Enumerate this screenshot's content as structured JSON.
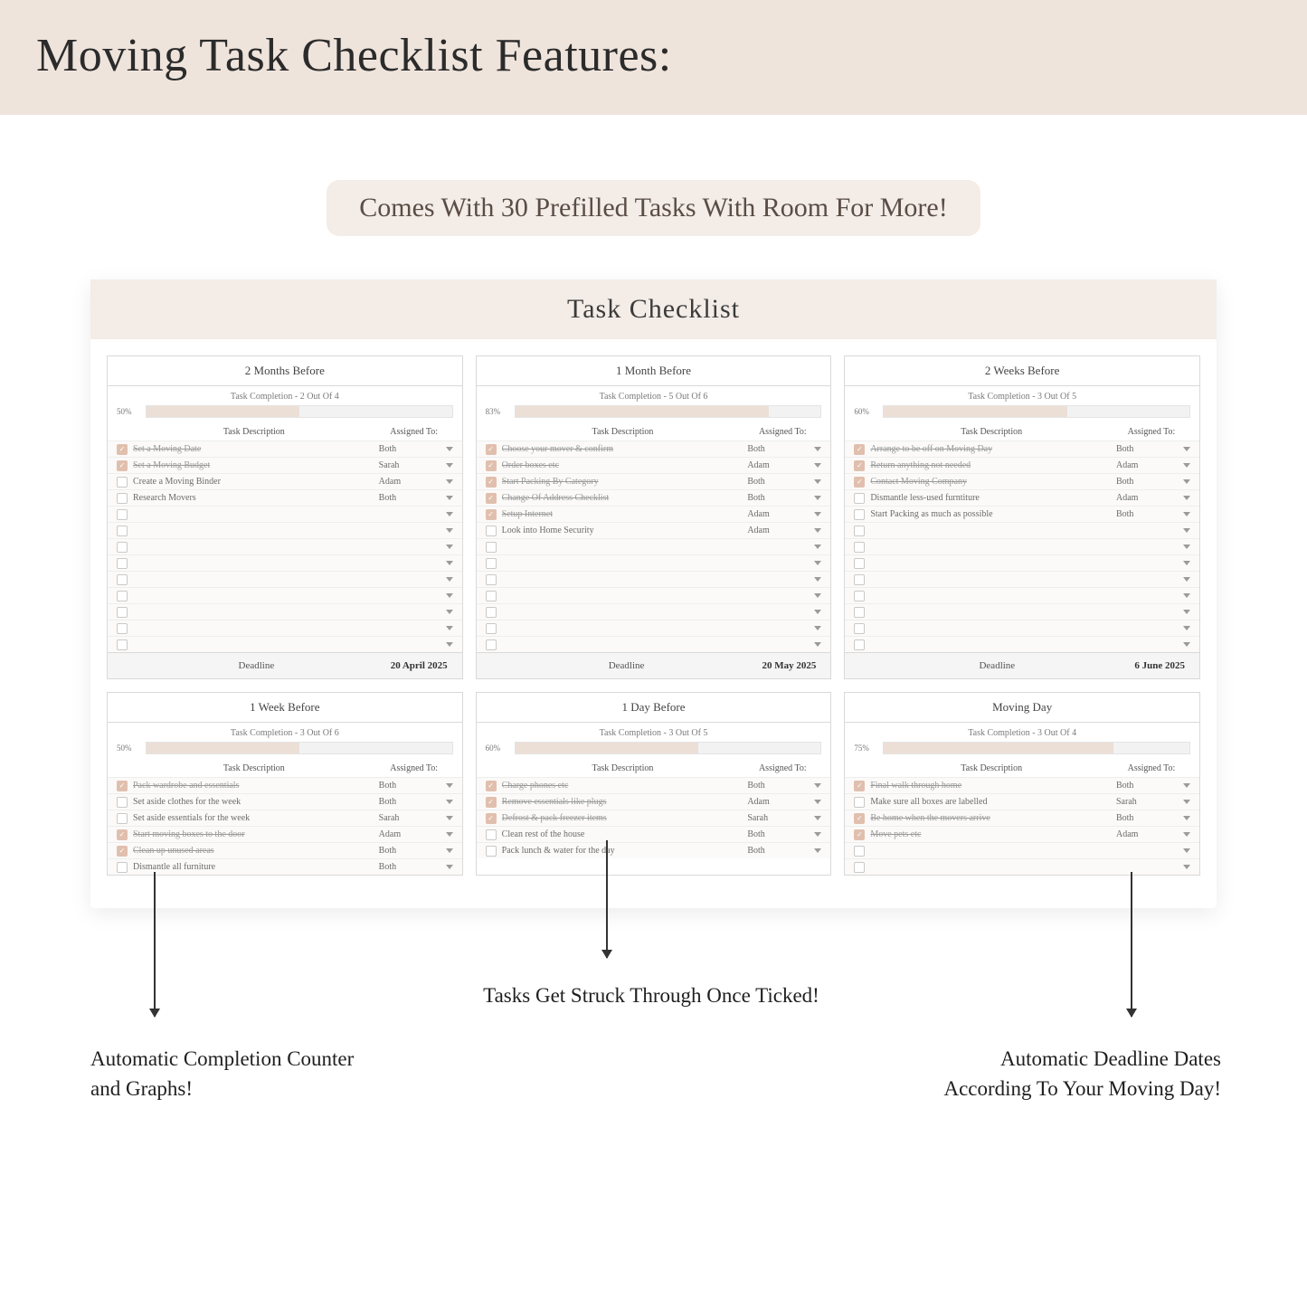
{
  "hero": {
    "title": "Moving Task Checklist Features:"
  },
  "subhead": {
    "text": "Comes With 30 Prefilled Tasks With Room For More!"
  },
  "sheetTitle": "Task Checklist",
  "panels": [
    {
      "title": "2 Months Before",
      "completionText": "Task Completion - 2 Out Of 4",
      "pct": "50%",
      "fill": 50,
      "colHeaders": {
        "desc": "Task Description",
        "assigned": "Assigned To:"
      },
      "rows": [
        {
          "done": true,
          "desc": "Set a Moving Date",
          "assigned": "Both"
        },
        {
          "done": true,
          "desc": "Set a Moving Budget",
          "assigned": "Sarah"
        },
        {
          "done": false,
          "desc": "Create a Moving Binder",
          "assigned": "Adam"
        },
        {
          "done": false,
          "desc": "Research Movers",
          "assigned": "Both"
        }
      ],
      "emptyRows": 9,
      "deadlineLabel": "Deadline",
      "deadline": "20 April 2025"
    },
    {
      "title": "1 Month Before",
      "completionText": "Task Completion - 5 Out Of 6",
      "pct": "83%",
      "fill": 83,
      "colHeaders": {
        "desc": "Task Description",
        "assigned": "Assigned To:"
      },
      "rows": [
        {
          "done": true,
          "desc": "Choose your mover & confirm",
          "assigned": "Both"
        },
        {
          "done": true,
          "desc": "Order boxes etc",
          "assigned": "Adam"
        },
        {
          "done": true,
          "desc": "Start Packing By Category",
          "assigned": "Both"
        },
        {
          "done": true,
          "desc": "Change Of Address Checklist",
          "assigned": "Both"
        },
        {
          "done": true,
          "desc": "Setup Internet",
          "assigned": "Adam"
        },
        {
          "done": false,
          "desc": "Look into Home Security",
          "assigned": "Adam"
        }
      ],
      "emptyRows": 7,
      "deadlineLabel": "Deadline",
      "deadline": "20 May 2025"
    },
    {
      "title": "2 Weeks Before",
      "completionText": "Task Completion - 3 Out Of 5",
      "pct": "60%",
      "fill": 60,
      "colHeaders": {
        "desc": "Task Description",
        "assigned": "Assigned To:"
      },
      "rows": [
        {
          "done": true,
          "desc": "Arrange to be off on Moving Day",
          "assigned": "Both"
        },
        {
          "done": true,
          "desc": "Return anything not needed",
          "assigned": "Adam"
        },
        {
          "done": true,
          "desc": "Contact Moving Company",
          "assigned": "Both"
        },
        {
          "done": false,
          "desc": "Dismantle less-used furntiture",
          "assigned": "Adam"
        },
        {
          "done": false,
          "desc": "Start Packing as much as possible",
          "assigned": "Both"
        }
      ],
      "emptyRows": 8,
      "deadlineLabel": "Deadline",
      "deadline": "6 June 2025"
    },
    {
      "title": "1 Week Before",
      "completionText": "Task Completion - 3 Out Of 6",
      "pct": "50%",
      "fill": 50,
      "colHeaders": {
        "desc": "Task Description",
        "assigned": "Assigned To:"
      },
      "rows": [
        {
          "done": true,
          "desc": "Pack wardrobe and essentials",
          "assigned": "Both"
        },
        {
          "done": false,
          "desc": "Set aside clothes for the week",
          "assigned": "Both"
        },
        {
          "done": false,
          "desc": "Set aside essentials for the week",
          "assigned": "Sarah"
        },
        {
          "done": true,
          "desc": "Start moving boxes to the door",
          "assigned": "Adam"
        },
        {
          "done": true,
          "desc": "Clean up unused areas",
          "assigned": "Both"
        },
        {
          "done": false,
          "desc": "Dismantle all furniture",
          "assigned": "Both"
        }
      ],
      "emptyRows": 0
    },
    {
      "title": "1 Day Before",
      "completionText": "Task Completion - 3 Out Of 5",
      "pct": "60%",
      "fill": 60,
      "colHeaders": {
        "desc": "Task Description",
        "assigned": "Assigned To:"
      },
      "rows": [
        {
          "done": true,
          "desc": "Charge phones etc",
          "assigned": "Both"
        },
        {
          "done": true,
          "desc": "Remove essentials like plugs",
          "assigned": "Adam"
        },
        {
          "done": true,
          "desc": "Defrost & pack freezer items",
          "assigned": "Sarah"
        },
        {
          "done": false,
          "desc": "Clean rest of the house",
          "assigned": "Both"
        },
        {
          "done": false,
          "desc": "Pack lunch & water for the day",
          "assigned": "Both"
        }
      ],
      "emptyRows": 0
    },
    {
      "title": "Moving Day",
      "completionText": "Task Completion - 3 Out Of 4",
      "pct": "75%",
      "fill": 75,
      "colHeaders": {
        "desc": "Task Description",
        "assigned": "Assigned To:"
      },
      "rows": [
        {
          "done": true,
          "desc": "Final walk through home",
          "assigned": "Both"
        },
        {
          "done": false,
          "desc": "Make sure all boxes are labelled",
          "assigned": "Sarah"
        },
        {
          "done": true,
          "desc": "Be home when the movers arrive",
          "assigned": "Both"
        },
        {
          "done": true,
          "desc": "Move pets etc",
          "assigned": "Adam"
        }
      ],
      "emptyRows": 2
    }
  ],
  "annotations": {
    "left": "Automatic Completion Counter\nand Graphs!",
    "center": "Tasks Get Struck Through Once Ticked!",
    "right": "Automatic Deadline Dates\nAccording To Your Moving Day!"
  }
}
